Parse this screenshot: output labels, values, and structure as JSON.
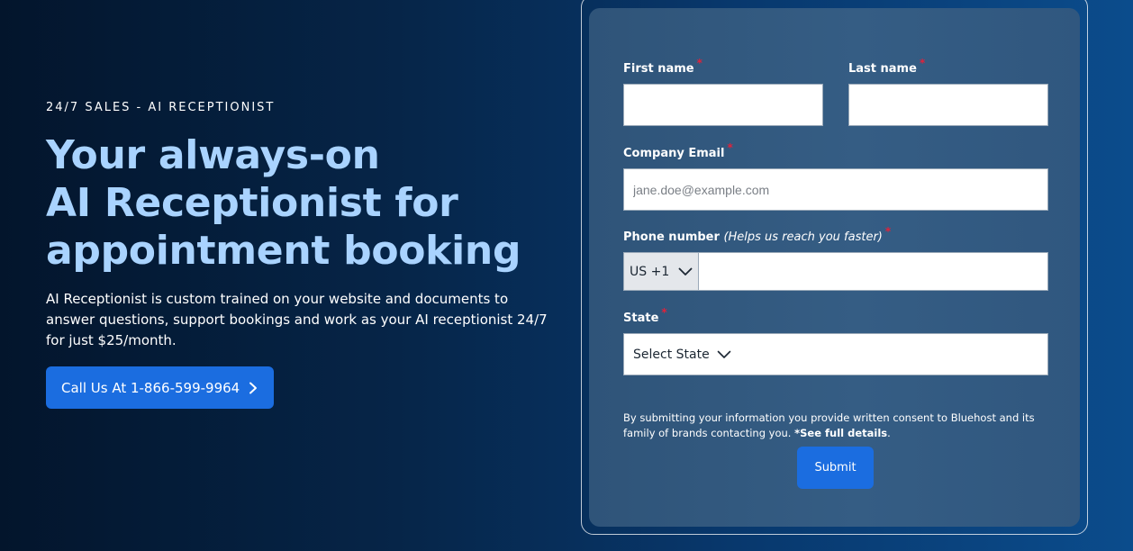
{
  "hero": {
    "eyebrow": "24/7 SALES - AI RECEPTIONIST",
    "headline_lines": [
      "Your always-on",
      "AI Receptionist for",
      "appointment booking"
    ],
    "description": "AI Receptionist is custom trained on your website and documents to answer questions, support bookings and work as your AI receptionist 24/7 for just $25/month.",
    "cta_label": "Call Us At 1-866-599-9964",
    "cta_icon": "chevron-right-icon"
  },
  "form": {
    "first_name": {
      "label": "First name",
      "required_mark": "*",
      "value": ""
    },
    "last_name": {
      "label": "Last name",
      "required_mark": "*",
      "value": ""
    },
    "email": {
      "label": "Company Email",
      "required_mark": "*",
      "placeholder": "jane.doe@example.com",
      "value": ""
    },
    "phone": {
      "label": "Phone number",
      "hint": "(Helps us reach you faster)",
      "required_mark": "*",
      "country_code": "US +1",
      "value": ""
    },
    "state": {
      "label": "State",
      "required_mark": "*",
      "selected": "Select State"
    },
    "consent_text": "By submitting your information you provide written consent to Bluehost and its family of brands contacting you.",
    "consent_link": "*See full details",
    "consent_end": ".",
    "submit_label": "Submit"
  },
  "colors": {
    "accent": "#1b6de0",
    "headline": "#a9d3ff",
    "required": "#e0223b"
  }
}
